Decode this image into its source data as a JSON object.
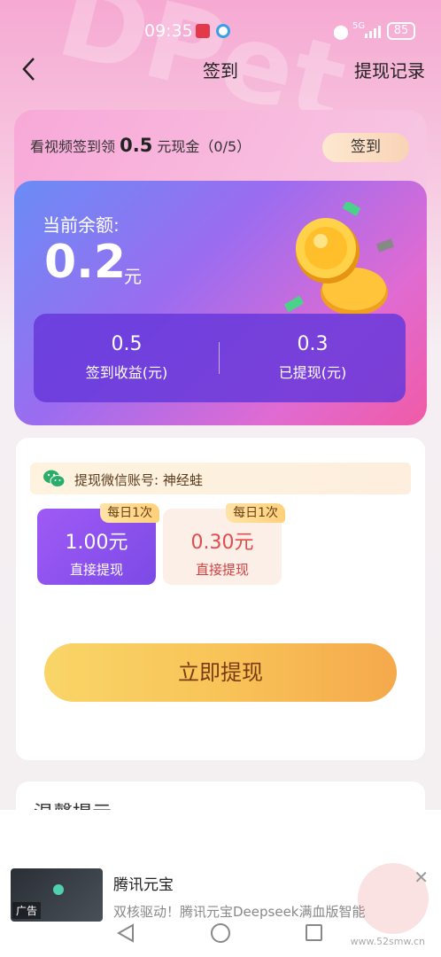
{
  "status_bar": {
    "time": "09:35",
    "network": "5G",
    "battery": "85"
  },
  "header": {
    "title": "签到",
    "records_label": "提现记录"
  },
  "signin": {
    "text_prefix": "看视频签到领",
    "amount": "0.5",
    "text_suffix": "元现金（0/5）",
    "button_label": "签到"
  },
  "balance": {
    "label": "当前余额:",
    "value": "0.2",
    "unit": "元"
  },
  "stats": [
    {
      "value": "0.5",
      "label": "签到收益(元)"
    },
    {
      "value": "0.3",
      "label": "已提现(元)"
    }
  ],
  "wechat": {
    "account_text": "提现微信账号: 神经蛙"
  },
  "options": [
    {
      "tag": "每日1次",
      "amount": "1.00元",
      "sub": "直接提现"
    },
    {
      "tag": "每日1次",
      "amount": "0.30元",
      "sub": "直接提现"
    }
  ],
  "withdraw_button": "立即提现",
  "tips": {
    "title": "温馨提示"
  },
  "ad": {
    "tag": "广告",
    "title": "腾讯元宝",
    "desc": "双核驱动！腾讯元宝Deepseek满血版智能",
    "watermark": "www.52smw.cn"
  },
  "colors": {
    "accent_purple": "#7b4ae6",
    "button_orange": "#f8c458",
    "price_red": "#e24c4c"
  }
}
